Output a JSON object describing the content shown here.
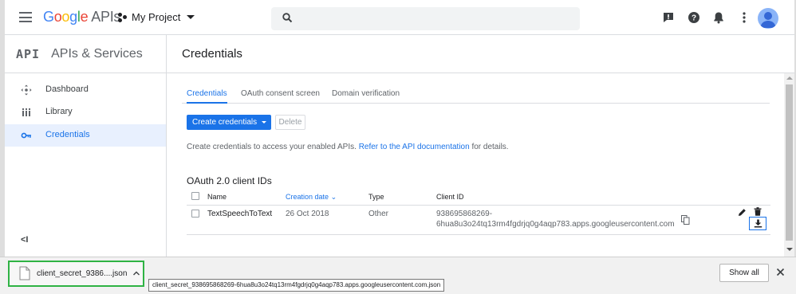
{
  "header": {
    "logo_letters": [
      "G",
      "o",
      "o",
      "g",
      "l",
      "e"
    ],
    "logo_suffix": "APIs",
    "project_name": "My Project",
    "search_placeholder": "",
    "icons": [
      "notifications-feedback-icon",
      "help-icon",
      "bell-icon",
      "more-vert-icon",
      "account-avatar"
    ]
  },
  "sidebar": {
    "logo": "API",
    "title": "APIs & Services",
    "items": [
      {
        "label": "Dashboard",
        "icon": "dashboard-icon"
      },
      {
        "label": "Library",
        "icon": "library-icon"
      },
      {
        "label": "Credentials",
        "icon": "key-icon",
        "active": true
      }
    ],
    "collapse_label": "<I"
  },
  "main": {
    "page_title": "Credentials",
    "tabs": [
      {
        "label": "Credentials",
        "active": true
      },
      {
        "label": "OAuth consent screen"
      },
      {
        "label": "Domain verification"
      }
    ],
    "create_button": "Create credentials",
    "delete_button": "Delete",
    "info_text": "Create credentials to access your enabled APIs.",
    "info_link": "Refer to the API documentation",
    "info_suffix": "for details.",
    "section_title": "OAuth 2.0 client IDs",
    "table": {
      "columns": [
        "Name",
        "Creation date",
        "Type",
        "Client ID"
      ],
      "sort_indicator": "⌄",
      "rows": [
        {
          "name": "TextSpeechToText",
          "creation_date": "26 Oct 2018",
          "type": "Other",
          "client_id_line1": "938695868269-",
          "client_id_line2": "6hua8u3o24tq13rm4fgdrjq0g4aqp783.apps.googleusercontent.com"
        }
      ]
    }
  },
  "download_bar": {
    "file_label": "client_secret_9386....json",
    "tooltip": "client_secret_938695868269-6hua8u3o24tq13rm4fgdrjq0g4aqp783.apps.googleusercontent.com.json",
    "show_all": "Show all"
  },
  "colors": {
    "accent": "#1a73e8",
    "active_bg": "#e8f0fe",
    "download_highlight": "#2fb344"
  }
}
